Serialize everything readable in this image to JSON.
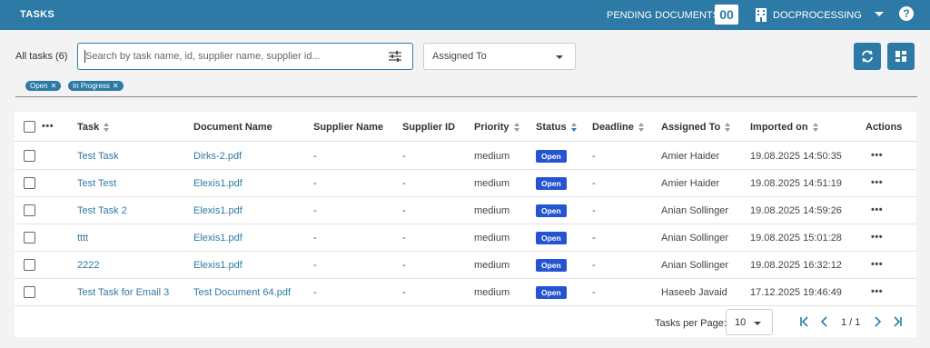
{
  "header": {
    "title": "TASKS",
    "pending_label": "PENDING DOCUMENTS:",
    "pending_count": "00",
    "org_name": "DOCPROCESSING",
    "help_label": "?"
  },
  "filters": {
    "all_tasks_label": "All tasks (6)",
    "search_placeholder": "Search by task name, id, supplier name, supplier id...",
    "assigned_to_label": "Assigned To",
    "chips": [
      {
        "label": "Open"
      },
      {
        "label": "In Progress"
      }
    ]
  },
  "table": {
    "columns": {
      "task": "Task",
      "document_name": "Document Name",
      "supplier_name": "Supplier Name",
      "supplier_id": "Supplier ID",
      "priority": "Priority",
      "status": "Status",
      "deadline": "Deadline",
      "assigned_to": "Assigned To",
      "imported_on": "Imported on",
      "actions": "Actions"
    },
    "header_menu": "•••",
    "rows": [
      {
        "task": "Test Task",
        "document": "Dirks-2.pdf",
        "supplier_name": "-",
        "supplier_id": "-",
        "priority": "medium",
        "status": "Open",
        "deadline": "-",
        "assigned_to": "Amier Haider",
        "imported_on": "19.08.2025 14:50:35",
        "actions": "•••"
      },
      {
        "task": "Test Test",
        "document": "Elexis1.pdf",
        "supplier_name": "-",
        "supplier_id": "-",
        "priority": "medium",
        "status": "Open",
        "deadline": "-",
        "assigned_to": "Amier Haider",
        "imported_on": "19.08.2025 14:51:19",
        "actions": "•••"
      },
      {
        "task": "Test Task 2",
        "document": "Elexis1.pdf",
        "supplier_name": "-",
        "supplier_id": "-",
        "priority": "medium",
        "status": "Open",
        "deadline": "-",
        "assigned_to": "Anian Sollinger",
        "imported_on": "19.08.2025 14:59:26",
        "actions": "•••"
      },
      {
        "task": "tttt",
        "document": "Elexis1.pdf",
        "supplier_name": "-",
        "supplier_id": "-",
        "priority": "medium",
        "status": "Open",
        "deadline": "-",
        "assigned_to": "Anian Sollinger",
        "imported_on": "19.08.2025 15:01:28",
        "actions": "•••"
      },
      {
        "task": "2222",
        "document": "Elexis1.pdf",
        "supplier_name": "-",
        "supplier_id": "-",
        "priority": "medium",
        "status": "Open",
        "deadline": "-",
        "assigned_to": "Anian Sollinger",
        "imported_on": "19.08.2025 16:32:12",
        "actions": "•••"
      },
      {
        "task": "Test Task for Email 3",
        "document": "Test Document 64.pdf",
        "supplier_name": "-",
        "supplier_id": "-",
        "priority": "medium",
        "status": "Open",
        "deadline": "-",
        "assigned_to": "Haseeb Javaid",
        "imported_on": "17.12.2025 19:46:49",
        "actions": "•••"
      }
    ]
  },
  "pagination": {
    "per_page_label": "Tasks per Page:",
    "per_page_value": "10",
    "page_info": "1 / 1"
  },
  "colors": {
    "primary": "#2e7aa6",
    "status_open": "#2554d0"
  }
}
